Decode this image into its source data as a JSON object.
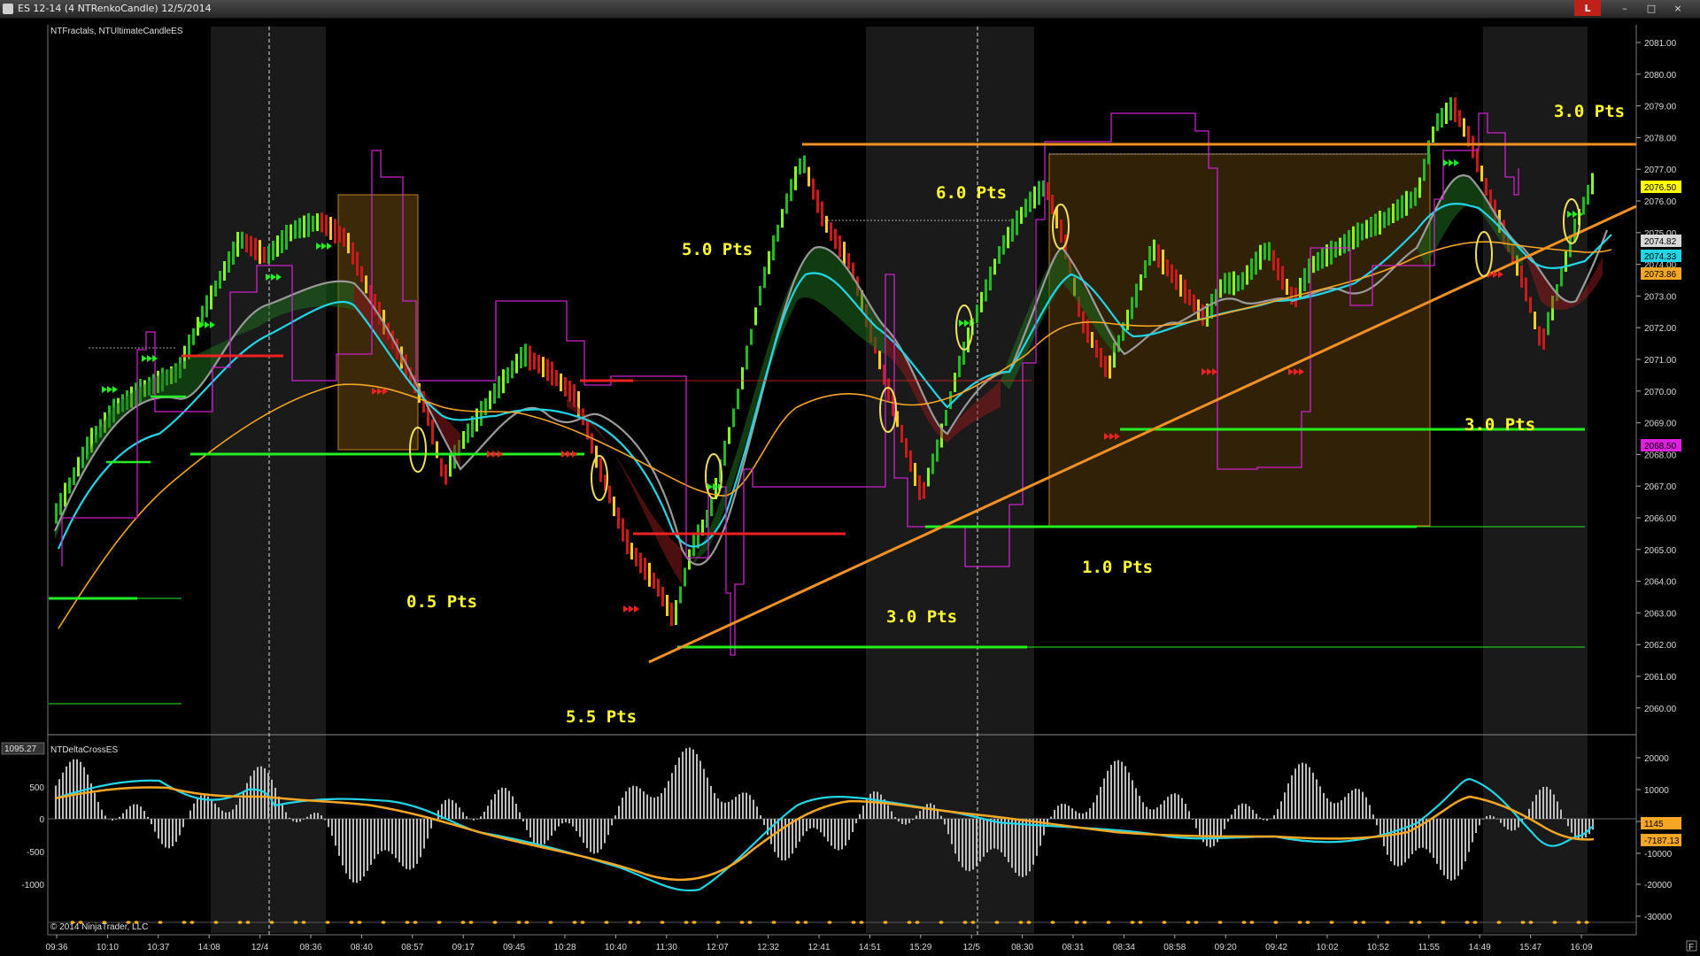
{
  "window": {
    "title": "ES 12-14 (4 NTRenkoCandle)  12/5/2014",
    "close_red_label": "L",
    "min_label": "–",
    "max_label": "□",
    "close_label": "×"
  },
  "price_panel": {
    "indicator_label": "NTFractals, NTUltimateCandleES",
    "price_ticks": [
      "2081.00",
      "2080.00",
      "2079.00",
      "2078.00",
      "2077.00",
      "2076.00",
      "2075.00",
      "2074.00",
      "2073.00",
      "2072.00",
      "2071.00",
      "2070.00",
      "2069.00",
      "2068.00",
      "2067.00",
      "2066.00",
      "2065.00",
      "2064.00",
      "2063.00",
      "2062.00",
      "2061.00",
      "2060.00"
    ],
    "price_tags": [
      {
        "text": "2076.50",
        "color": "#ffff00"
      },
      {
        "text": "2074.82",
        "color": "#d8d8d8"
      },
      {
        "text": "2074.33",
        "color": "#22d6e6"
      },
      {
        "text": "2073.86",
        "color": "#f5a623"
      },
      {
        "text": "2068.50",
        "color": "#e020e0"
      }
    ],
    "annotations": [
      "3.0  Pts",
      "6.0  Pts",
      "5.0  Pts",
      "0.5  Pts",
      "5.5  Pts",
      "3.0  Pts",
      "1.0  Pts",
      "3.0  Pts"
    ]
  },
  "lower_panel": {
    "indicator_label": "NTDeltaCrossES",
    "left_tag": "1095.27",
    "left_ticks": [
      "500",
      "0",
      "-500",
      "-1000"
    ],
    "right_ticks": [
      "20000",
      "10000",
      "0",
      "-10000",
      "-20000",
      "-30000"
    ],
    "right_tags": [
      {
        "text": "1145",
        "color": "#f5a623"
      },
      {
        "text": "-7187.13",
        "color": "#f5a623"
      }
    ],
    "copyright": "© 2014 NinjaTrader, LLC"
  },
  "time_axis": [
    "09:36",
    "10:10",
    "10:37",
    "14:08",
    "12/4",
    "08:36",
    "08:40",
    "08:57",
    "09:17",
    "09:45",
    "10:28",
    "10:40",
    "11:30",
    "12:07",
    "12:32",
    "12:41",
    "14:51",
    "15:29",
    "12/5",
    "08:30",
    "08:31",
    "08:34",
    "08:58",
    "09:20",
    "09:42",
    "10:02",
    "10:52",
    "11:55",
    "14:49",
    "15:47",
    "16:09"
  ],
  "corner_label": "F",
  "colors": {
    "bull_bar": "#22cc22",
    "bear_bar": "#dd2222",
    "cyan_line": "#22d6e6",
    "orange_line": "#f5a623",
    "magenta_line": "#cc22cc",
    "green_level": "#22ee22",
    "red_level": "#ee2222",
    "trendline": "#f39222",
    "annotation": "#ffff33"
  }
}
